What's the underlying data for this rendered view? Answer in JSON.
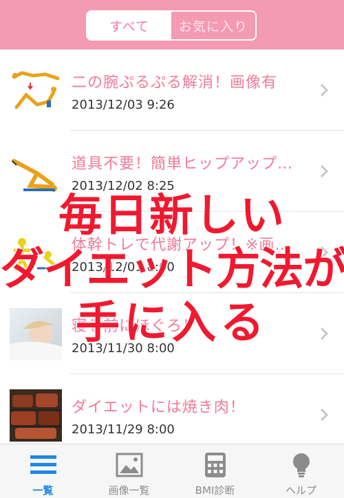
{
  "header": {
    "segments": [
      {
        "label": "すべて",
        "active": true
      },
      {
        "label": "お気に入り",
        "active": false
      }
    ]
  },
  "list": {
    "items": [
      {
        "title": "二の腕ぷるぷる解消！画像有",
        "date": "2013/12/03 9:26",
        "thumb": "arm-exercise-illustration"
      },
      {
        "title": "道具不要！簡単ヒップアップ…",
        "date": "2013/12/02 8:25",
        "thumb": "hip-up-illustration"
      },
      {
        "title": "体幹トレで代謝アップ！※画…",
        "date": "2013/12/01 8:00",
        "thumb": "core-training-illustration"
      },
      {
        "title": "寝る前にほぐろ！",
        "date": "2013/11/30 8:00",
        "thumb": "sleeping-woman-photo"
      },
      {
        "title": "ダイエットには焼き肉！",
        "date": "2013/11/29 8:00",
        "thumb": "grilled-meat-photo"
      }
    ]
  },
  "overlay": {
    "line1": "毎日新しい",
    "line2": "ダイエット方法が",
    "line3": "手に入る"
  },
  "tabbar": {
    "tabs": [
      {
        "label": "一覧",
        "icon": "list-icon",
        "active": true
      },
      {
        "label": "画像一覧",
        "icon": "image-icon",
        "active": false
      },
      {
        "label": "BMI診断",
        "icon": "calculator-icon",
        "active": false
      },
      {
        "label": "ヘルプ",
        "icon": "lightbulb-icon",
        "active": false
      }
    ]
  },
  "colors": {
    "header": "#f59ab3",
    "title": "#ef7a98",
    "overlay": "#f0192f",
    "active_tab": "#1e88e5"
  }
}
